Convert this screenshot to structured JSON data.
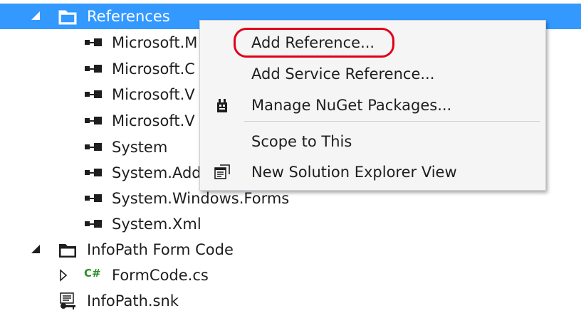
{
  "tree": {
    "references": {
      "label": "References"
    },
    "reference_items": [
      {
        "label": "Microsoft.M"
      },
      {
        "label": "Microsoft.C"
      },
      {
        "label": "Microsoft.V"
      },
      {
        "label": "Microsoft.V"
      },
      {
        "label": "System"
      },
      {
        "label": "System.Add"
      },
      {
        "label": "System.Windows.Forms"
      },
      {
        "label": "System.Xml"
      }
    ],
    "infopath_folder": {
      "label": "InfoPath Form Code"
    },
    "formcode": {
      "label": "FormCode.cs",
      "badge": "C#"
    },
    "snk": {
      "label": "InfoPath.snk"
    }
  },
  "context_menu": {
    "items": [
      {
        "label": "Add Reference..."
      },
      {
        "label": "Add Service Reference..."
      },
      {
        "label": "Manage NuGet Packages..."
      },
      {
        "label": "Scope to This"
      },
      {
        "label": "New Solution Explorer View"
      }
    ]
  },
  "colors": {
    "selection": "#3399ff",
    "highlight_ring": "#e0001b",
    "menu_bg": "#f5f5f5"
  }
}
